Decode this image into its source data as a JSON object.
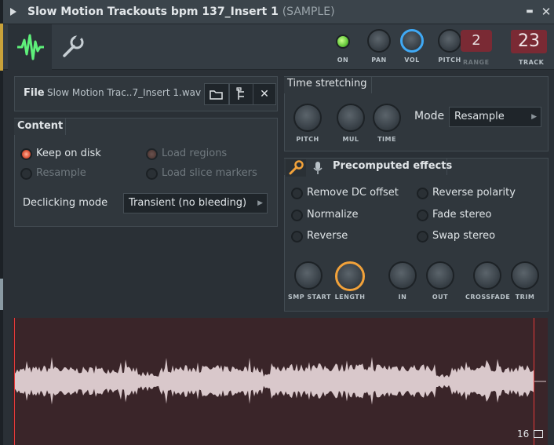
{
  "window": {
    "title": "Slow Motion Trackouts bpm 137_Insert 1",
    "title_suffix": "(SAMPLE)",
    "minimize_glyph": "▬",
    "close_glyph": "✕"
  },
  "toolbar": {
    "tabs": [
      {
        "name": "waveform-tab",
        "icon": "waveform-icon",
        "active": true
      },
      {
        "name": "settings-tab",
        "icon": "wrench-icon",
        "active": false
      }
    ],
    "knobs": {
      "on_label": "ON",
      "pan_label": "PAN",
      "vol_label": "VOL",
      "pitch_label": "PITCH",
      "range_label": "RANGE",
      "range_value": "2",
      "track_label": "TRACK",
      "track_value": "23"
    },
    "colors": {
      "vol_accent": "#3fa9f5",
      "on_led": "#63c83a",
      "track_box": "#7a2a34"
    }
  },
  "file": {
    "label": "File",
    "name": "Slow Motion Trac..7_Insert 1.wav",
    "buttons": [
      "folder-icon",
      "file-tree-icon",
      "close-icon"
    ]
  },
  "content": {
    "title": "Content",
    "options": {
      "keep_on_disk": "Keep on disk",
      "resample": "Resample",
      "load_regions": "Load regions",
      "load_slice_markers": "Load slice markers"
    },
    "declicking_label": "Declicking mode",
    "declicking_value": "Transient (no bleeding)"
  },
  "time_stretching": {
    "title": "Time stretching",
    "knobs": {
      "pitch": "PITCH",
      "mul": "MUL",
      "time": "TIME"
    },
    "mode_label": "Mode",
    "mode_value": "Resample"
  },
  "precomputed": {
    "title": "Precomputed effects",
    "effects": {
      "remove_dc": "Remove DC offset",
      "normalize": "Normalize",
      "reverse": "Reverse",
      "reverse_polarity": "Reverse polarity",
      "fade_stereo": "Fade stereo",
      "swap_stereo": "Swap stereo"
    },
    "knobs": {
      "smp_start": "SMP START",
      "length": "LENGTH",
      "in": "IN",
      "out": "OUT",
      "crossfade": "CROSSFADE",
      "trim": "TRIM"
    },
    "colors": {
      "length_accent": "#f2a23a"
    }
  },
  "waveform": {
    "zoom": "16",
    "colors": {
      "background": "#3a2529",
      "wave": "#d9c8cb",
      "marker": "#e63a3a"
    }
  }
}
